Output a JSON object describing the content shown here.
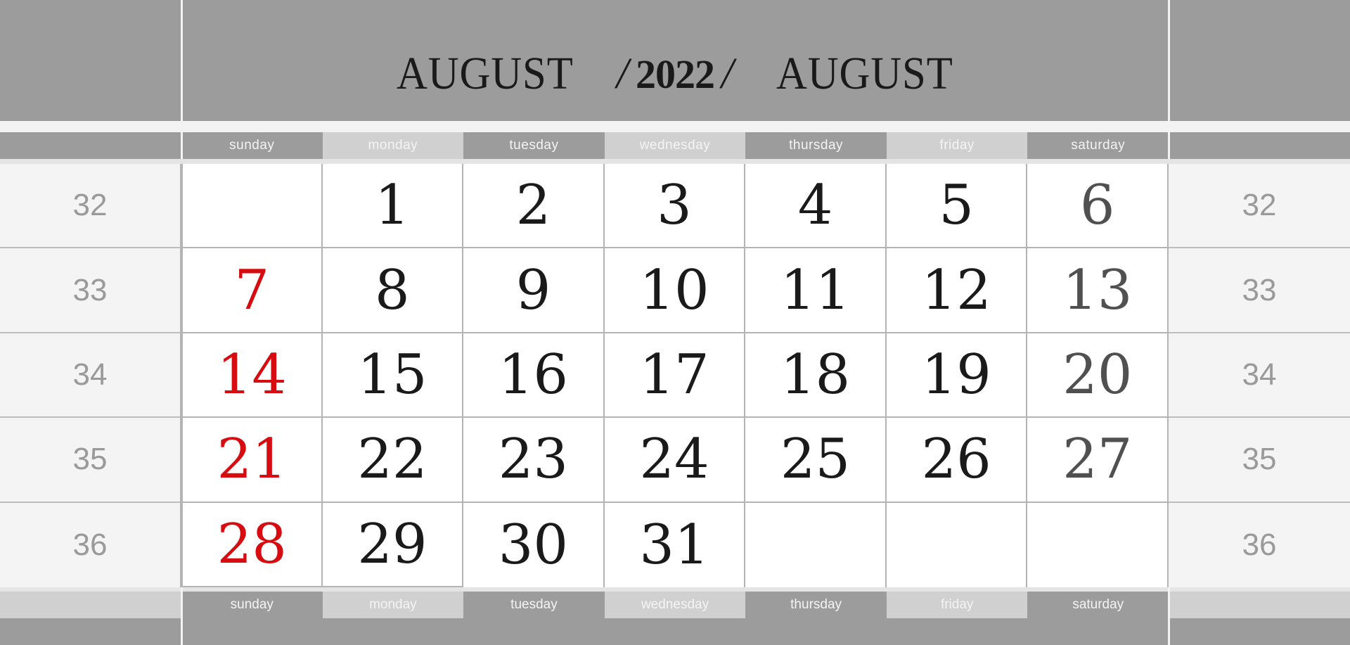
{
  "header": {
    "month_left": "AUGUST",
    "year": "2022",
    "month_right": "AUGUST",
    "slash": "/"
  },
  "weekdays": [
    "sunday",
    "monday",
    "tuesday",
    "wednesday",
    "thursday",
    "friday",
    "saturday"
  ],
  "weeks": [
    {
      "number": "32",
      "days": [
        "",
        "1",
        "2",
        "3",
        "4",
        "5",
        "6"
      ]
    },
    {
      "number": "33",
      "days": [
        "7",
        "8",
        "9",
        "10",
        "11",
        "12",
        "13"
      ]
    },
    {
      "number": "34",
      "days": [
        "14",
        "15",
        "16",
        "17",
        "18",
        "19",
        "20"
      ]
    },
    {
      "number": "35",
      "days": [
        "21",
        "22",
        "23",
        "24",
        "25",
        "26",
        "27"
      ]
    },
    {
      "number": "36",
      "days": [
        "28",
        "29",
        "30",
        "31",
        "",
        "",
        ""
      ]
    }
  ],
  "colors": {
    "sunday": "#d60c10",
    "weekday": "#1a1a1a",
    "saturday": "#505050",
    "header_bg": "#9c9c9c",
    "day_header_alt": "#d0d0d0",
    "week_number": "#9a9a9a"
  }
}
